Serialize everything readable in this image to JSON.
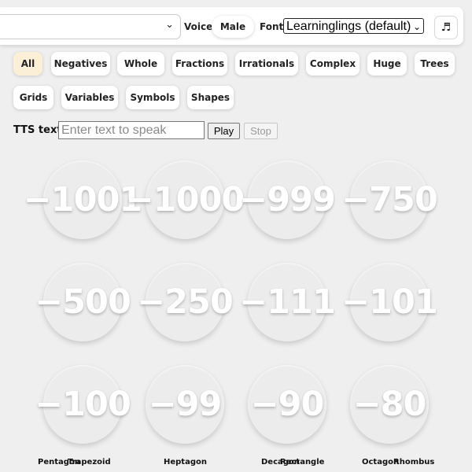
{
  "toolbar": {
    "voice_label": "Voice",
    "voice_value": "Male",
    "font_label": "Font",
    "font_value": "Learninglings (default)",
    "music_icon": "music-note-icon"
  },
  "chips_row1": [
    "All",
    "Negatives",
    "Whole",
    "Fractions",
    "Irrationals",
    "Complex",
    "Huge",
    "Trees"
  ],
  "chips_row2": [
    "Grids",
    "Variables",
    "Symbols",
    "Shapes"
  ],
  "active_chip": "All",
  "tts": {
    "label": "TTS text",
    "placeholder": "Enter text to speak",
    "play": "Play",
    "stop": "Stop"
  },
  "numbers_row1": [
    "−1001",
    "−1000",
    "−999",
    "−750"
  ],
  "numbers_row2": [
    "−500",
    "−250",
    "−111",
    "−101"
  ],
  "numbers_row3": [
    "−100",
    "−99",
    "−90",
    "−80"
  ],
  "captions": [
    "Pentagon",
    "Trapezoid",
    "Heptagon",
    "Decagon",
    "Rectangle",
    "Octagon",
    "Rhombus"
  ]
}
